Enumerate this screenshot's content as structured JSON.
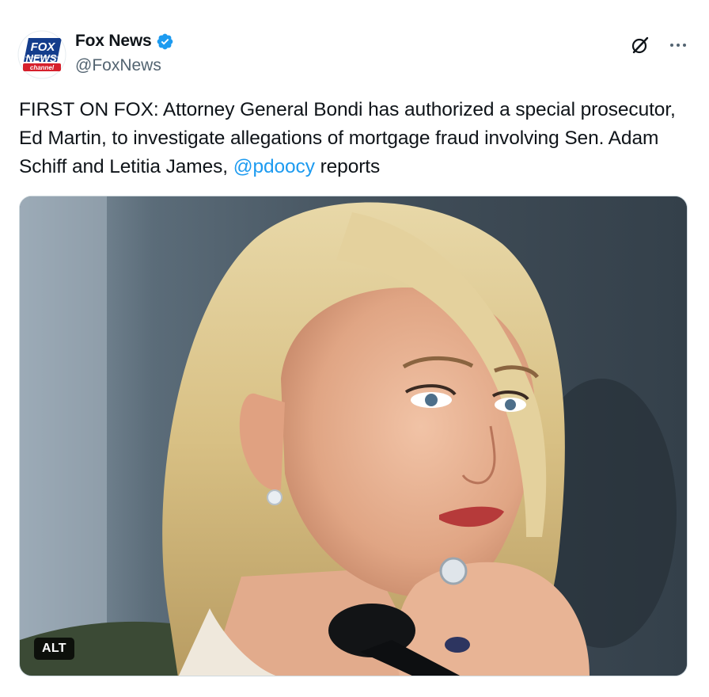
{
  "author": {
    "display_name": "Fox News",
    "handle": "@FoxNews",
    "avatar_logo": {
      "line1": "FOX",
      "line2": "NEWS",
      "line3": "channel"
    },
    "verified": true,
    "verified_color": "#1d9bf0"
  },
  "actions": {
    "grok_icon": "grok-icon",
    "more_icon": "more-icon"
  },
  "tweet": {
    "text_main": "FIRST ON FOX: Attorney General Bondi has authorized a special prosecutor, Ed Martin, to investigate allegations of mortgage fraud involving Sen. Adam Schiff and Letitia James, ",
    "mention": "@pdoocy",
    "text_tail": " reports"
  },
  "media": {
    "alt_label": "ALT"
  },
  "colors": {
    "text": "#0f1419",
    "secondary": "#536471",
    "link": "#1d9bf0",
    "fox_blue": "#143d8c",
    "fox_red": "#d6202c"
  }
}
